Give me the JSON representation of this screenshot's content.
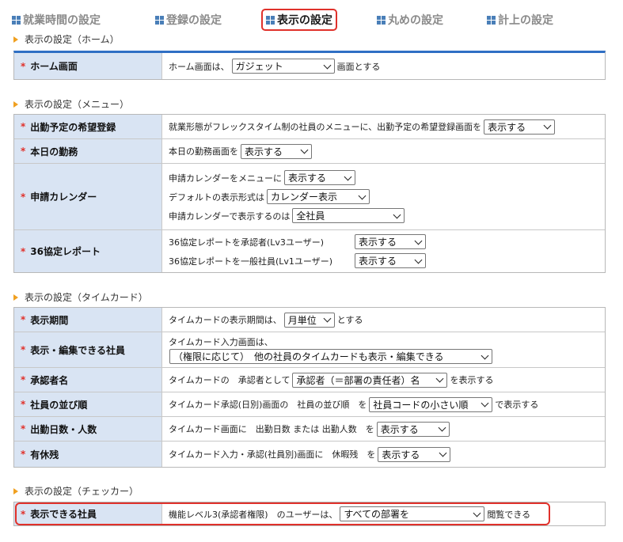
{
  "tabs": [
    {
      "label": "就業時間の設定",
      "active": false
    },
    {
      "label": "登録の設定",
      "active": false
    },
    {
      "label": "表示の設定",
      "active": true
    },
    {
      "label": "丸めの設定",
      "active": false
    },
    {
      "label": "計上の設定",
      "active": false
    }
  ],
  "sections": {
    "home": {
      "heading": "表示の設定（ホーム）",
      "home_screen": {
        "label": "ホーム画面",
        "pre": "ホーム画面は、",
        "select": "ガジェット",
        "post": "画面とする"
      }
    },
    "menu": {
      "heading": "表示の設定（メニュー）",
      "desired_registration": {
        "label": "出勤予定の希望登録",
        "pre": "就業形態がフレックスタイム制の社員のメニューに、出勤予定の希望登録画面を",
        "select": "表示する"
      },
      "today_work": {
        "label": "本日の勤務",
        "pre": "本日の勤務画面を",
        "select": "表示する"
      },
      "request_calendar": {
        "label": "申請カレンダー",
        "line1_pre": "申請カレンダーをメニューに",
        "line1_select": "表示する",
        "line2_pre": "デフォルトの表示形式は",
        "line2_select": "カレンダー表示",
        "line3_pre": "申請カレンダーで表示するのは",
        "line3_select": "全社員"
      },
      "agreement36": {
        "label": "36協定レポート",
        "line1_pre": "36協定レポートを承認者(Lv3ユーザー)",
        "line1_select": "表示する",
        "line2_pre": "36協定レポートを一般社員(Lv1ユーザー)",
        "line2_select": "表示する"
      }
    },
    "timecard": {
      "heading": "表示の設定（タイムカード）",
      "period": {
        "label": "表示期間",
        "pre": "タイムカードの表示期間は、",
        "select": "月単位",
        "post": "とする"
      },
      "editable": {
        "label": "表示・編集できる社員",
        "line1": "タイムカード入力画面は、",
        "select": "（権限に応じて）　他の社員のタイムカードも表示・編集できる"
      },
      "approver_name": {
        "label": "承認者名",
        "pre": "タイムカードの　承認者として",
        "select": "承認者（＝部署の責任者）名",
        "post": "を表示する"
      },
      "sort_order": {
        "label": "社員の並び順",
        "pre": "タイムカード承認(日別)画面の　社員の並び順　を",
        "select": "社員コードの小さい順",
        "post": "で表示する"
      },
      "work_days": {
        "label": "出勤日数・人数",
        "pre": "タイムカード画面に　出勤日数 または 出勤人数　を",
        "select": "表示する"
      },
      "paid_leave": {
        "label": "有休残",
        "pre": "タイムカード入力・承認(社員別)画面に　休暇残　を",
        "select": "表示する"
      }
    },
    "checker": {
      "heading": "表示の設定（チェッカー）",
      "viewable": {
        "label": "表示できる社員",
        "pre": "機能レベル3(承認者権限)　のユーザーは、",
        "select": "すべての部署を",
        "post": "閲覧できる"
      }
    }
  },
  "required_mark": "*",
  "colors": {
    "label_bg": "#d9e4f3",
    "highlight": "#e0312b",
    "accent_blue": "#2f6fc4",
    "heading_triangle": "#f0a020"
  }
}
